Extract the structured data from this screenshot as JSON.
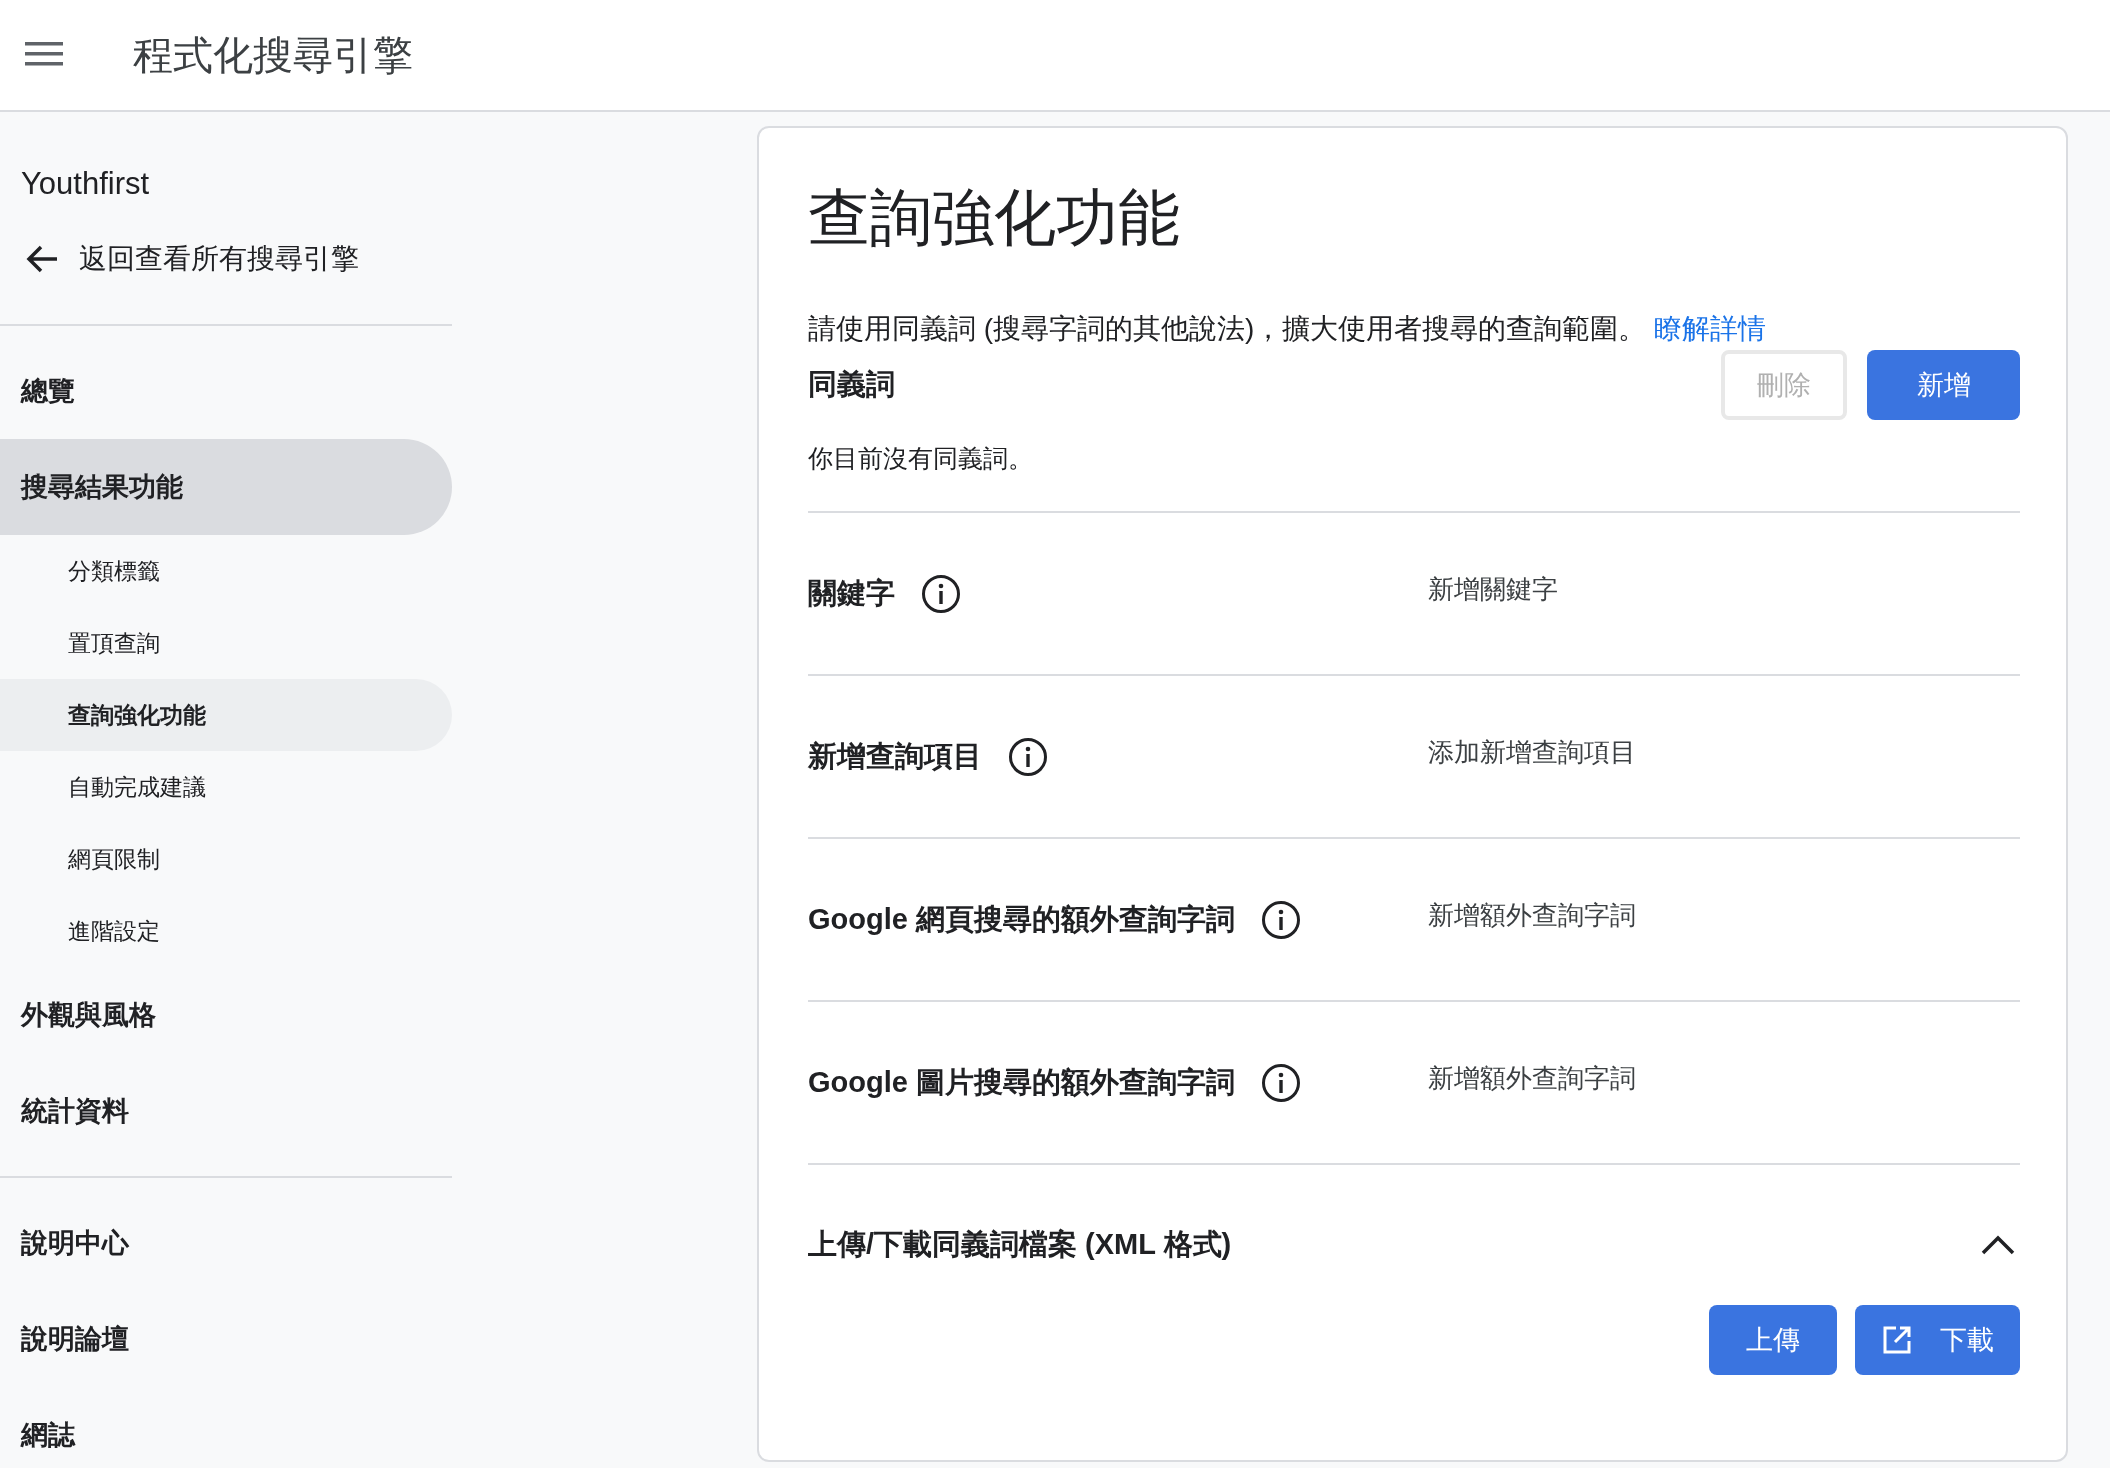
{
  "app_bar": {
    "title": "程式化搜尋引擎"
  },
  "sidebar": {
    "engine_name": "Youthfirst",
    "back_link": "返回查看所有搜尋引擎",
    "items": [
      {
        "label": "總覽",
        "selected": false
      },
      {
        "label": "搜尋結果功能",
        "selected": true,
        "children": [
          {
            "label": "分類標籤",
            "selected": false
          },
          {
            "label": "置頂查詢",
            "selected": false
          },
          {
            "label": "查詢強化功能",
            "selected": true
          },
          {
            "label": "自動完成建議",
            "selected": false
          },
          {
            "label": "網頁限制",
            "selected": false
          },
          {
            "label": "進階設定",
            "selected": false
          }
        ]
      },
      {
        "label": "外觀與風格",
        "selected": false
      },
      {
        "label": "統計資料",
        "selected": false
      }
    ],
    "help_items": [
      {
        "label": "說明中心"
      },
      {
        "label": "說明論壇"
      },
      {
        "label": "網誌"
      }
    ]
  },
  "page": {
    "title": "查詢強化功能",
    "description": "請使用同義詞 (搜尋字詞的其他說法)，擴大使用者搜尋的查詢範圍。",
    "learn_more": "瞭解詳情",
    "synonyms": {
      "heading": "同義詞",
      "delete_button": {
        "label": "刪除",
        "disabled": true
      },
      "add_button": {
        "label": "新增",
        "disabled": false
      },
      "empty_message": "你目前沒有同義詞。"
    },
    "rows": [
      {
        "label": "關鍵字",
        "placeholder": "新增關鍵字"
      },
      {
        "label": "新增查詢項目",
        "placeholder": "添加新增查詢項目"
      },
      {
        "label": "Google 網頁搜尋的額外查詢字詞",
        "placeholder": "新增額外查詢字詞"
      },
      {
        "label": "Google 圖片搜尋的額外查詢字詞",
        "placeholder": "新增額外查詢字詞"
      }
    ],
    "upload_section": {
      "heading": "上傳/下載同義詞檔案 (XML 格式)",
      "expanded": true,
      "upload_button": "上傳",
      "download_button": "下載"
    }
  }
}
